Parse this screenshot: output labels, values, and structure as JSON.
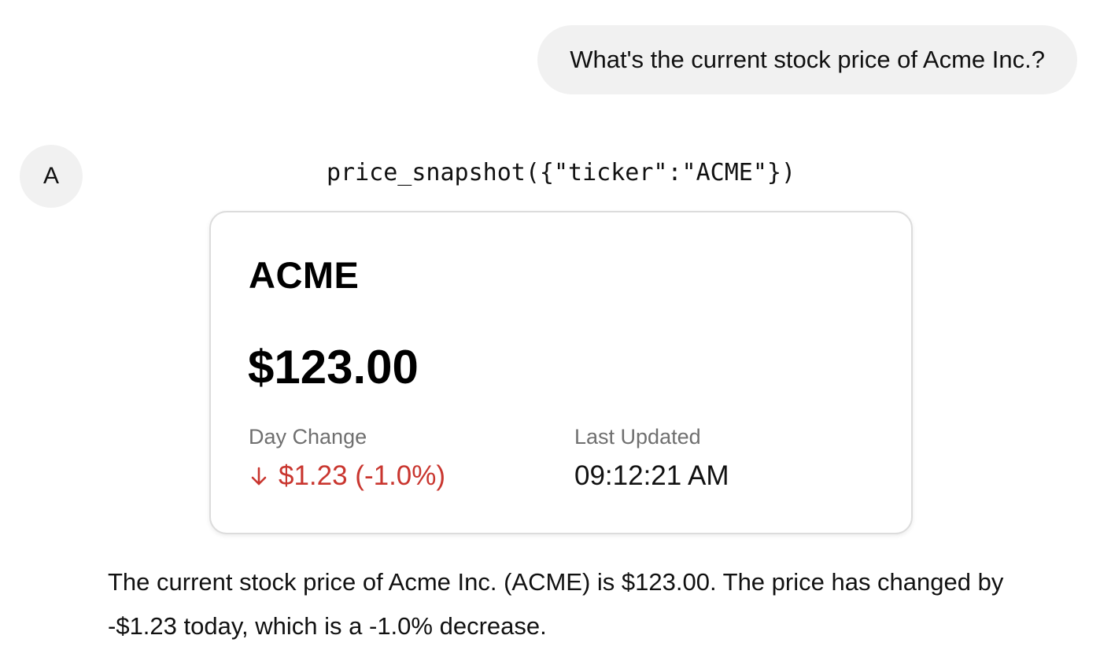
{
  "user_message": {
    "text": "What's the current stock price of Acme Inc.?"
  },
  "assistant": {
    "avatar_letter": "A",
    "tool_call": "price_snapshot({\"ticker\":\"ACME\"})",
    "reply": "The current stock price of Acme Inc. (ACME) is $123.00. The price has changed by -$1.23 today, which is a -1.0% decrease."
  },
  "price_card": {
    "ticker": "ACME",
    "price": "$123.00",
    "day_change_label": "Day Change",
    "day_change_value": "$1.23 (-1.0%)",
    "day_change_direction_icon": "arrow-down-icon",
    "last_updated_label": "Last Updated",
    "last_updated_value": "09:12:21 AM"
  },
  "colors": {
    "negative": "#c9362f",
    "bubble_bg": "#f1f1f1",
    "muted_text": "#6f6f6f",
    "card_border": "#dcdcdc"
  }
}
